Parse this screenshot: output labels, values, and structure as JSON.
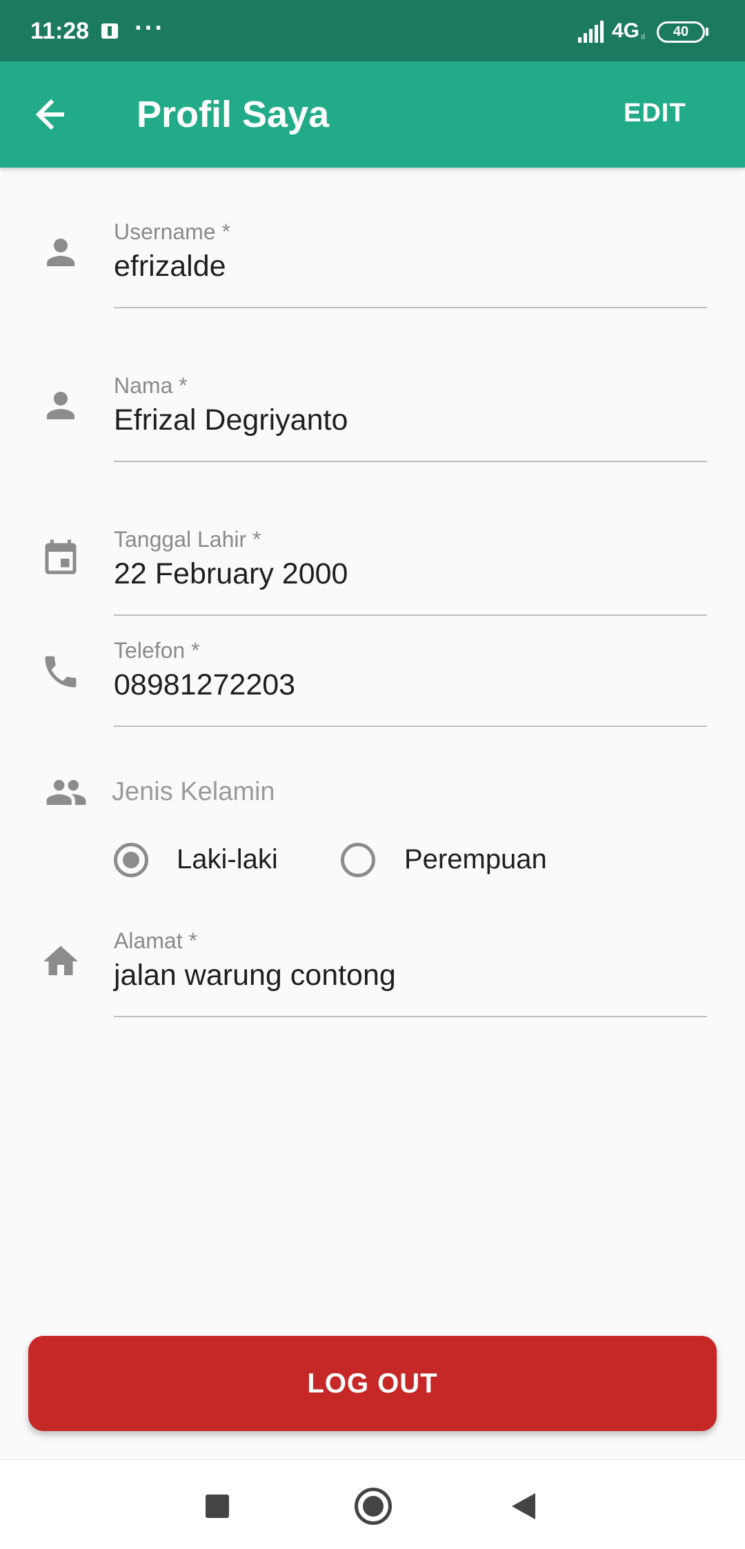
{
  "status_bar": {
    "time": "11:28",
    "more": "···",
    "network": "4G",
    "network_sub": "ıl",
    "battery": "40"
  },
  "app_bar": {
    "title": "Profil Saya",
    "edit_label": "EDIT"
  },
  "fields": {
    "username": {
      "label": "Username *",
      "value": "efrizalde",
      "icon": "person-icon"
    },
    "nama": {
      "label": "Nama *",
      "value": "Efrizal Degriyanto",
      "icon": "person-icon"
    },
    "tanggal_lahir": {
      "label": "Tanggal Lahir *",
      "value": "22 February 2000",
      "icon": "calendar-icon"
    },
    "telefon": {
      "label": "Telefon *",
      "value": "08981272203",
      "icon": "phone-icon"
    },
    "alamat": {
      "label": "Alamat *",
      "value": "jalan warung contong",
      "icon": "home-icon"
    }
  },
  "gender": {
    "label": "Jenis Kelamin",
    "icon": "people-icon",
    "options": [
      {
        "label": "Laki-laki",
        "selected": true
      },
      {
        "label": "Perempuan",
        "selected": false
      }
    ]
  },
  "logout_label": "LOG OUT",
  "colors": {
    "status_bar": "#1b7a5f",
    "app_bar": "#22ab88",
    "logout": "#c62828",
    "icon_gray": "#8c8c8c"
  }
}
